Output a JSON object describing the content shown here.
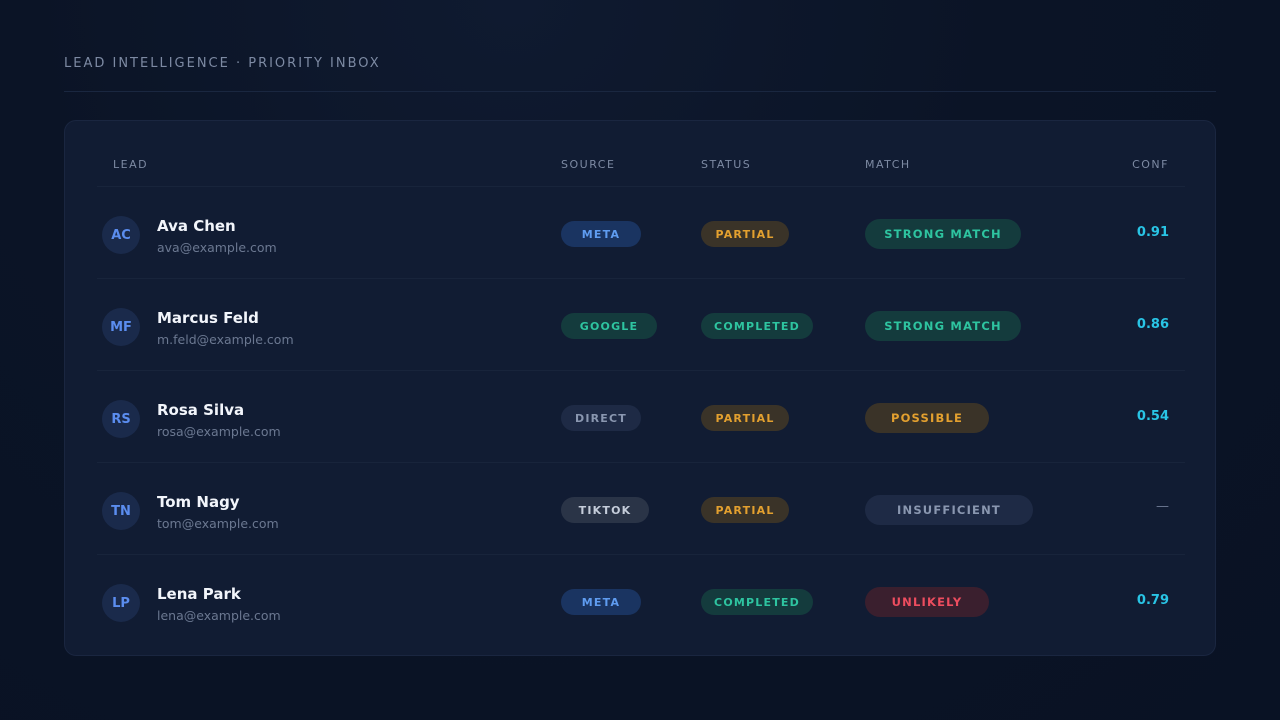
{
  "header": {
    "title": "LEAD INTELLIGENCE · PRIORITY INBOX"
  },
  "columns": {
    "lead": "LEAD",
    "source": "SOURCE",
    "status": "STATUS",
    "match": "MATCH",
    "conf": "CONF"
  },
  "rows": [
    {
      "initials": "AC",
      "name": "Ava Chen",
      "email": "ava@example.com",
      "source": "META",
      "status": "PARTIAL",
      "match": "STRONG MATCH",
      "conf": "0.91"
    },
    {
      "initials": "MF",
      "name": "Marcus Feld",
      "email": "m.feld@example.com",
      "source": "GOOGLE",
      "status": "COMPLETED",
      "match": "STRONG MATCH",
      "conf": "0.86"
    },
    {
      "initials": "RS",
      "name": "Rosa Silva",
      "email": "rosa@example.com",
      "source": "DIRECT",
      "status": "PARTIAL",
      "match": "POSSIBLE",
      "conf": "0.54"
    },
    {
      "initials": "TN",
      "name": "Tom Nagy",
      "email": "tom@example.com",
      "source": "TIKTOK",
      "status": "PARTIAL",
      "match": "INSUFFICIENT",
      "conf": "—"
    },
    {
      "initials": "LP",
      "name": "Lena Park",
      "email": "lena@example.com",
      "source": "META",
      "status": "COMPLETED",
      "match": "UNLIKELY",
      "conf": "0.79"
    }
  ],
  "colors": {
    "background": "#0b1426",
    "card": "#111c33",
    "accent_blue": "#5f9cf0",
    "accent_green": "#2ec4a0",
    "accent_amber": "#e3a02f",
    "accent_red": "#ee4d5f",
    "conf_cyan": "#29c4e5"
  }
}
